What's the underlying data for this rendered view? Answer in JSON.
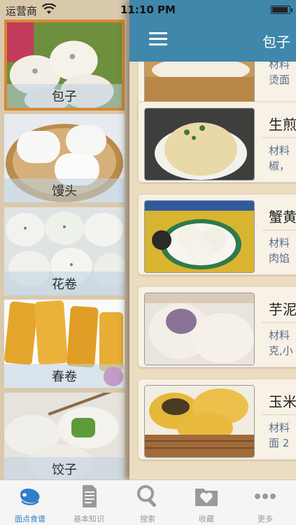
{
  "status_bar": {
    "carrier": "运营商",
    "time": "11:10 PM"
  },
  "nav": {
    "title": "包子"
  },
  "categories": [
    {
      "label": "包子",
      "selected": true
    },
    {
      "label": "馒头",
      "selected": false
    },
    {
      "label": "花卷",
      "selected": false
    },
    {
      "label": "春卷",
      "selected": false
    },
    {
      "label": "饺子",
      "selected": false
    }
  ],
  "recipes": [
    {
      "name": "",
      "desc_line1": "材料",
      "desc_line2": "烫面"
    },
    {
      "name": "生煎",
      "desc_line1": "材料",
      "desc_line2": "椒，"
    },
    {
      "name": "蟹黄",
      "desc_line1": "材料",
      "desc_line2": "肉馅"
    },
    {
      "name": "芋泥",
      "desc_line1": "材料",
      "desc_line2": "克,小"
    },
    {
      "name": "玉米",
      "desc_line1": "材料",
      "desc_line2": "面 2"
    }
  ],
  "tabs": [
    {
      "label": "面点食谱",
      "icon": "meat-icon",
      "active": true
    },
    {
      "label": "基本知识",
      "icon": "document-icon",
      "active": false
    },
    {
      "label": "搜索",
      "icon": "search-icon",
      "active": false
    },
    {
      "label": "收藏",
      "icon": "heart-folder-icon",
      "active": false
    },
    {
      "label": "更多",
      "icon": "more-dots-icon",
      "active": false
    }
  ],
  "colors": {
    "navbar": "#3f87ab",
    "accent": "#2f7fc8",
    "selected_border": "#d98830"
  }
}
